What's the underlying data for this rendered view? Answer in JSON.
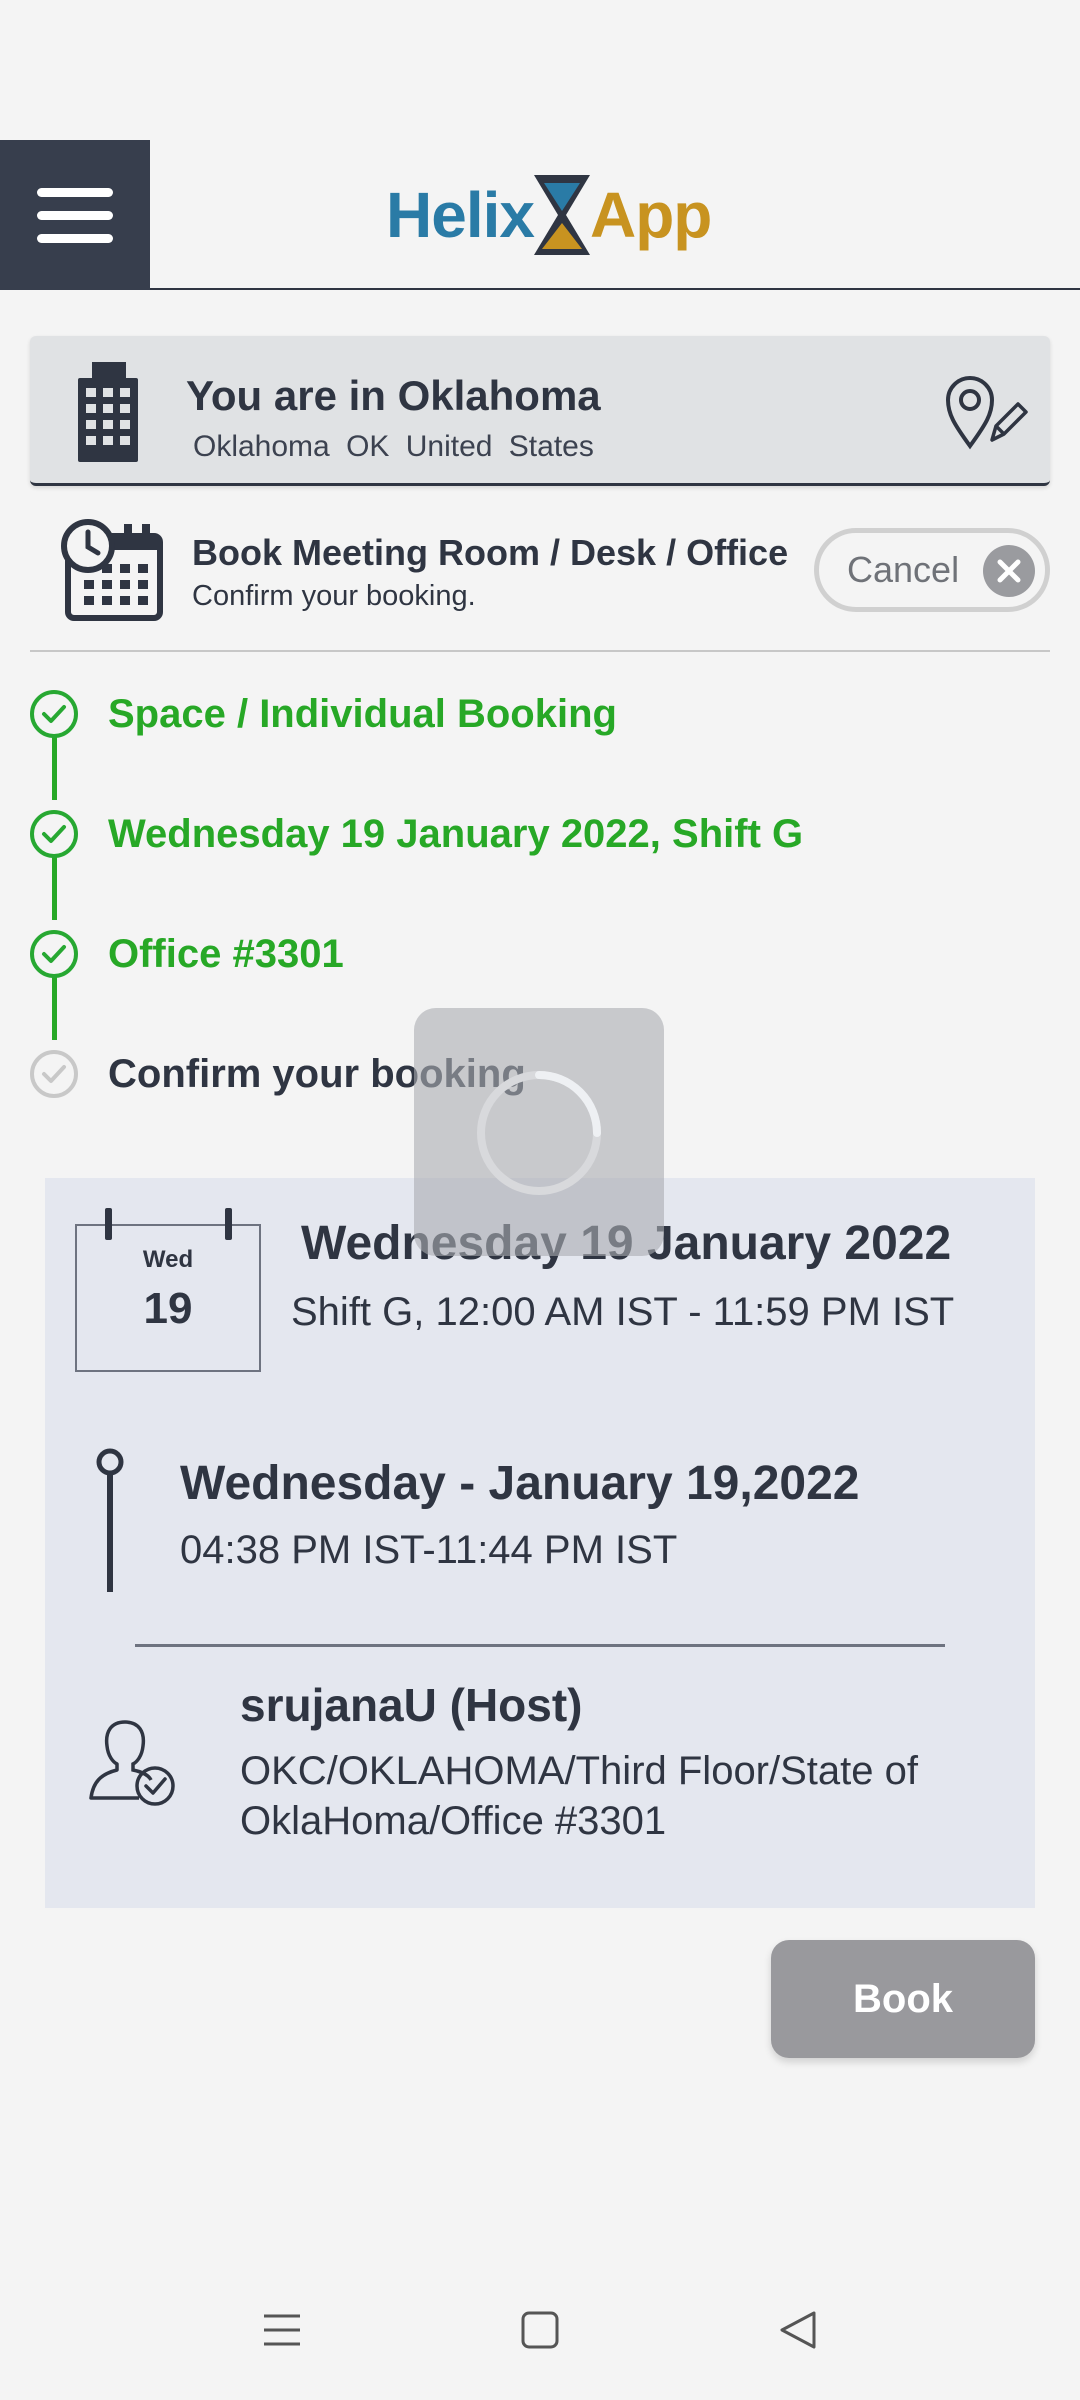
{
  "header": {
    "menu_icon": "hamburger-menu-icon",
    "logo_left": "Helix",
    "logo_right": "App",
    "logo_colors": {
      "helix": "#2a7ba6",
      "app": "#c89320"
    }
  },
  "location": {
    "title": "You are in Oklahoma",
    "subtitle": "Oklahoma  OK United States",
    "building_icon": "building-icon",
    "edit_icon": "location-edit-icon"
  },
  "booking": {
    "title": "Book Meeting Room / Desk / Office",
    "subtitle": "Confirm your booking.",
    "cancel_label": "Cancel"
  },
  "steps": [
    {
      "label": "Space / Individual Booking",
      "status": "done"
    },
    {
      "label": "Wednesday 19 January 2022, Shift G",
      "status": "done"
    },
    {
      "label": "Office #3301",
      "status": "done"
    },
    {
      "label": "Confirm your booking",
      "status": "pending"
    }
  ],
  "summary": {
    "cal_day": "Wed",
    "cal_num": "19",
    "date": "Wednesday 19 January 2022",
    "shift": "Shift G, 12:00 AM IST - 11:59 PM IST",
    "time_date": "Wednesday - January 19,2022",
    "time_range": "04:38 PM IST-11:44 PM IST",
    "host_name": "srujanaU (Host)",
    "host_path": "OKC/OKLAHOMA/Third Floor/State of OklaHoma/Office #3301"
  },
  "book_label": "Book",
  "colors": {
    "success": "#27a826",
    "dark": "#2f3542",
    "summary_bg": "#e4e7ef",
    "disabled": "#99999d"
  }
}
